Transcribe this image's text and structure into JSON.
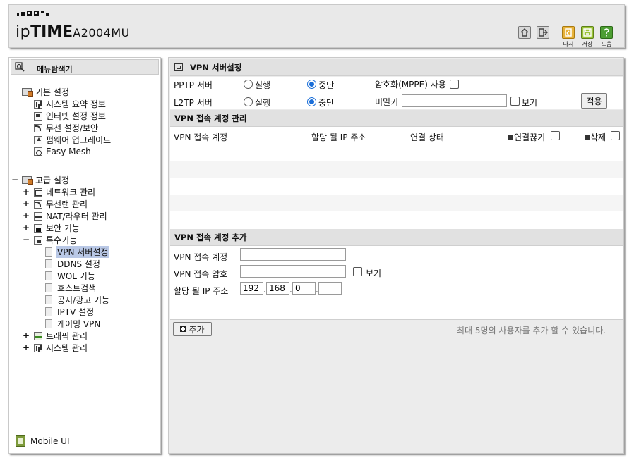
{
  "header": {
    "brand_prefix": "ip",
    "brand_bold": "TIME",
    "model": "A2004MU",
    "buttons": [
      {
        "icon": "home-icon",
        "label": ""
      },
      {
        "icon": "logout-icon",
        "label": ""
      },
      {
        "icon": "restart-icon",
        "label": "다시"
      },
      {
        "icon": "save-icon",
        "label": "저장"
      },
      {
        "icon": "help-icon",
        "label": "도움"
      }
    ],
    "colors": {
      "restart": "#e7b23a",
      "save": "#9bc437",
      "help": "#4d9e33"
    }
  },
  "sidebar": {
    "title": "메뉴탐색기",
    "basic": {
      "label": "기본 설정",
      "items": [
        "시스템 요약 정보",
        "인터넷 설정 정보",
        "무선 설정/보안",
        "펌웨어 업그레이드",
        "Easy Mesh"
      ]
    },
    "advanced": {
      "toggle": "−",
      "label": "고급 설정",
      "items": [
        {
          "toggle": "+",
          "label": "네트워크 관리"
        },
        {
          "toggle": "+",
          "label": "무선랜 관리"
        },
        {
          "toggle": "+",
          "label": "NAT/라우터 관리"
        },
        {
          "toggle": "+",
          "label": "보안 기능"
        },
        {
          "toggle": "−",
          "label": "특수기능"
        },
        {
          "toggle": "+",
          "label": "트래픽 관리"
        },
        {
          "toggle": "+",
          "label": "시스템 관리"
        }
      ],
      "special_items": [
        "VPN 서버설정",
        "DDNS 설정",
        "WOL 기능",
        "호스트검색",
        "공지/광고 기능",
        "IPTV 설정",
        "게이밍 VPN"
      ],
      "selected": "VPN 서버설정"
    },
    "mobile_ui": "Mobile UI"
  },
  "main": {
    "title": "VPN 서버설정",
    "pptp": {
      "label": "PPTP 서버",
      "run": "실행",
      "stop": "중단",
      "selected": "stop"
    },
    "l2tp": {
      "label": "L2TP 서버",
      "run": "실행",
      "stop": "중단",
      "selected": "stop"
    },
    "mppe_label": "암호화(MPPE) 사용",
    "mppe_checked": false,
    "secret_label": "비밀키",
    "secret_value": "",
    "show_label": "보기",
    "apply": "적용",
    "accounts_title": "VPN 접속 계정 관리",
    "columns": [
      "VPN 접속 계정",
      "할당 될 IP 주소",
      "연결 상태",
      "연결끊기",
      "삭제"
    ],
    "rows": [],
    "add_title": "VPN 접속 계정 추가",
    "add_fields": {
      "account_label": "VPN 접속 계정",
      "account_value": "",
      "password_label": "VPN 접속 암호",
      "password_value": "",
      "show_label": "보기",
      "ip_label": "할당 될 IP 주소",
      "ip": [
        "192",
        "168",
        "0",
        ""
      ]
    },
    "add_button": "추가",
    "limit_note": "최대 5명의 사용자를 추가 할 수 있습니다."
  }
}
